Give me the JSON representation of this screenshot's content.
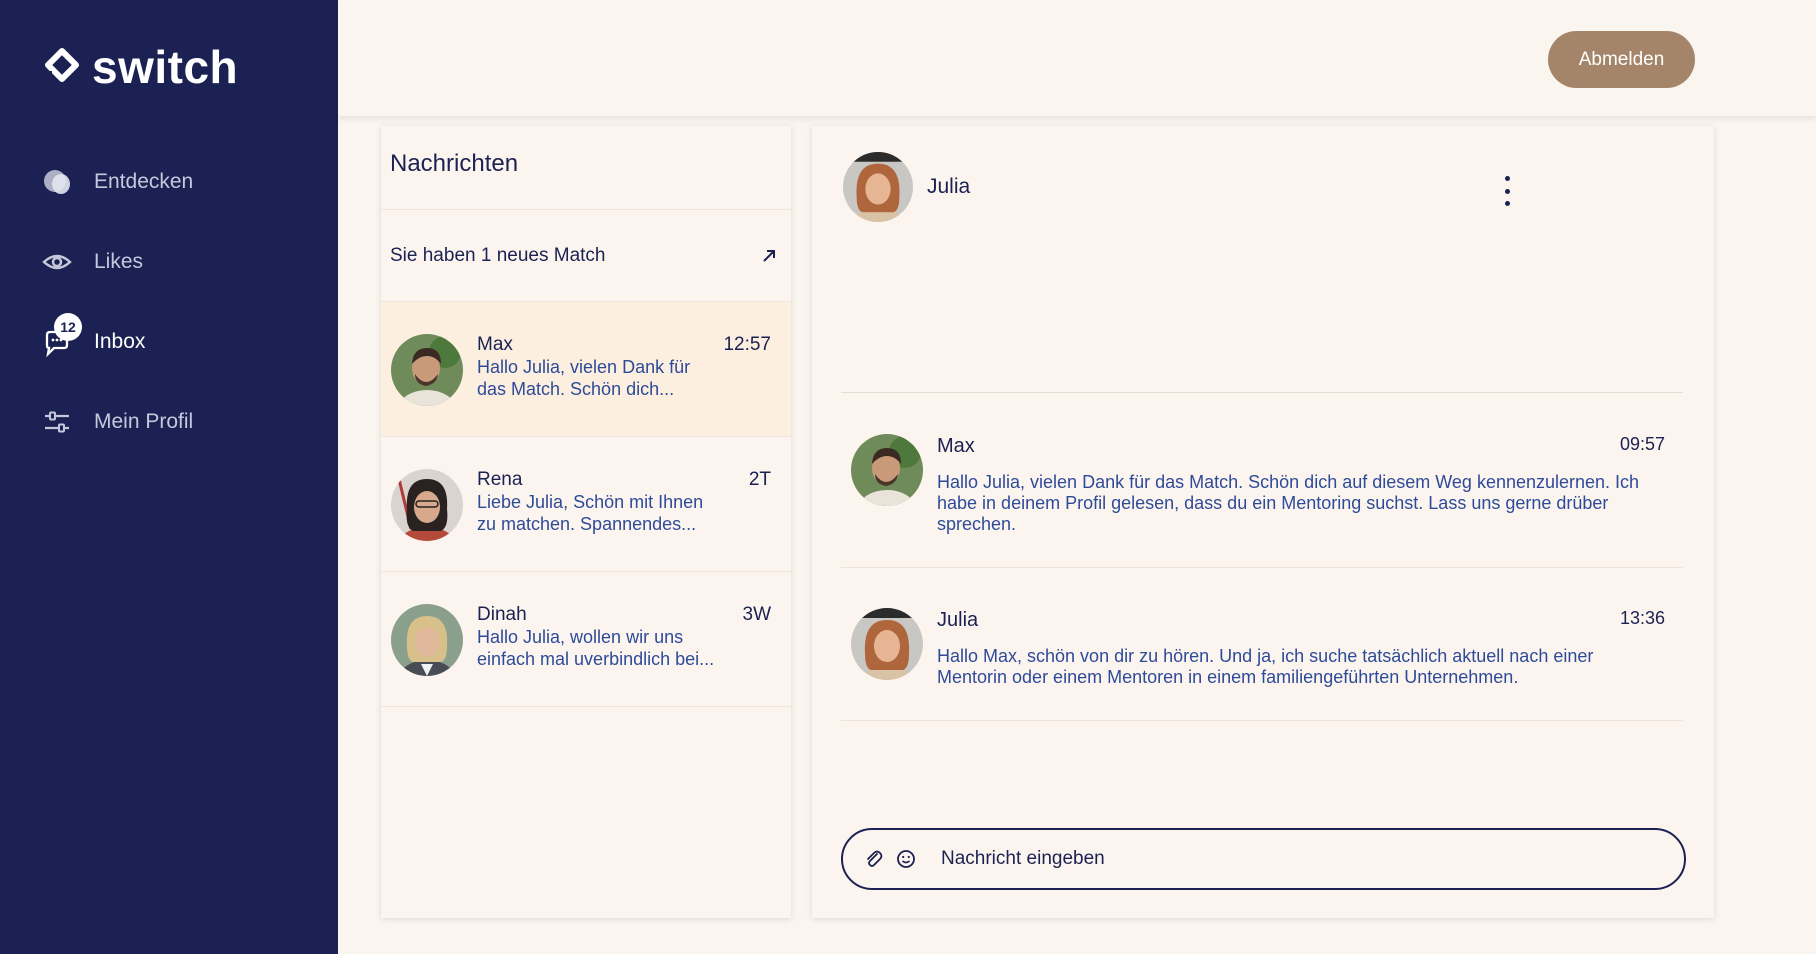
{
  "brand": {
    "name": "switch"
  },
  "sidebar": {
    "items": [
      {
        "label": "Entdecken",
        "icon": "discover-icon"
      },
      {
        "label": "Likes",
        "icon": "eye-icon"
      },
      {
        "label": "Inbox",
        "icon": "chat-icon",
        "badge": "12"
      },
      {
        "label": "Mein Profil",
        "icon": "sliders-icon"
      }
    ]
  },
  "header": {
    "logout_label": "Abmelden"
  },
  "messages": {
    "title": "Nachrichten",
    "new_match": "Sie haben 1 neues Match",
    "conversations": [
      {
        "name": "Max",
        "time": "12:57",
        "preview": "Hallo Julia, vielen Dank für das Match. Schön dich..."
      },
      {
        "name": "Rena",
        "time": "2T",
        "preview": "Liebe Julia, Schön mit Ihnen zu matchen. Spannendes..."
      },
      {
        "name": "Dinah",
        "time": "3W",
        "preview": "Hallo Julia, wollen wir uns einfach mal uverbindlich bei..."
      }
    ]
  },
  "chat": {
    "contact_name": "Julia",
    "messages": [
      {
        "sender": "Max",
        "time": "09:57",
        "text": "Hallo Julia, vielen Dank für das Match. Schön dich auf diesem Weg kennenzulernen. Ich habe in deinem Profil gelesen, dass du ein Mentoring suchst. Lass uns gerne drüber sprechen."
      },
      {
        "sender": "Julia",
        "time": "13:36",
        "text": "Hallo Max, schön von dir zu hören. Und ja, ich suche tatsächlich aktuell nach einer Mentorin oder einem Mentoren in einem familiengeführten Unternehmen."
      }
    ],
    "composer_placeholder": "Nachricht eingeben"
  },
  "colors": {
    "sidebar_bg": "#1b2152",
    "page_bg": "#fbf5f0",
    "accent_button": "#a58569",
    "selected_row": "#fcefe0",
    "preview_text": "#2e4b99"
  }
}
